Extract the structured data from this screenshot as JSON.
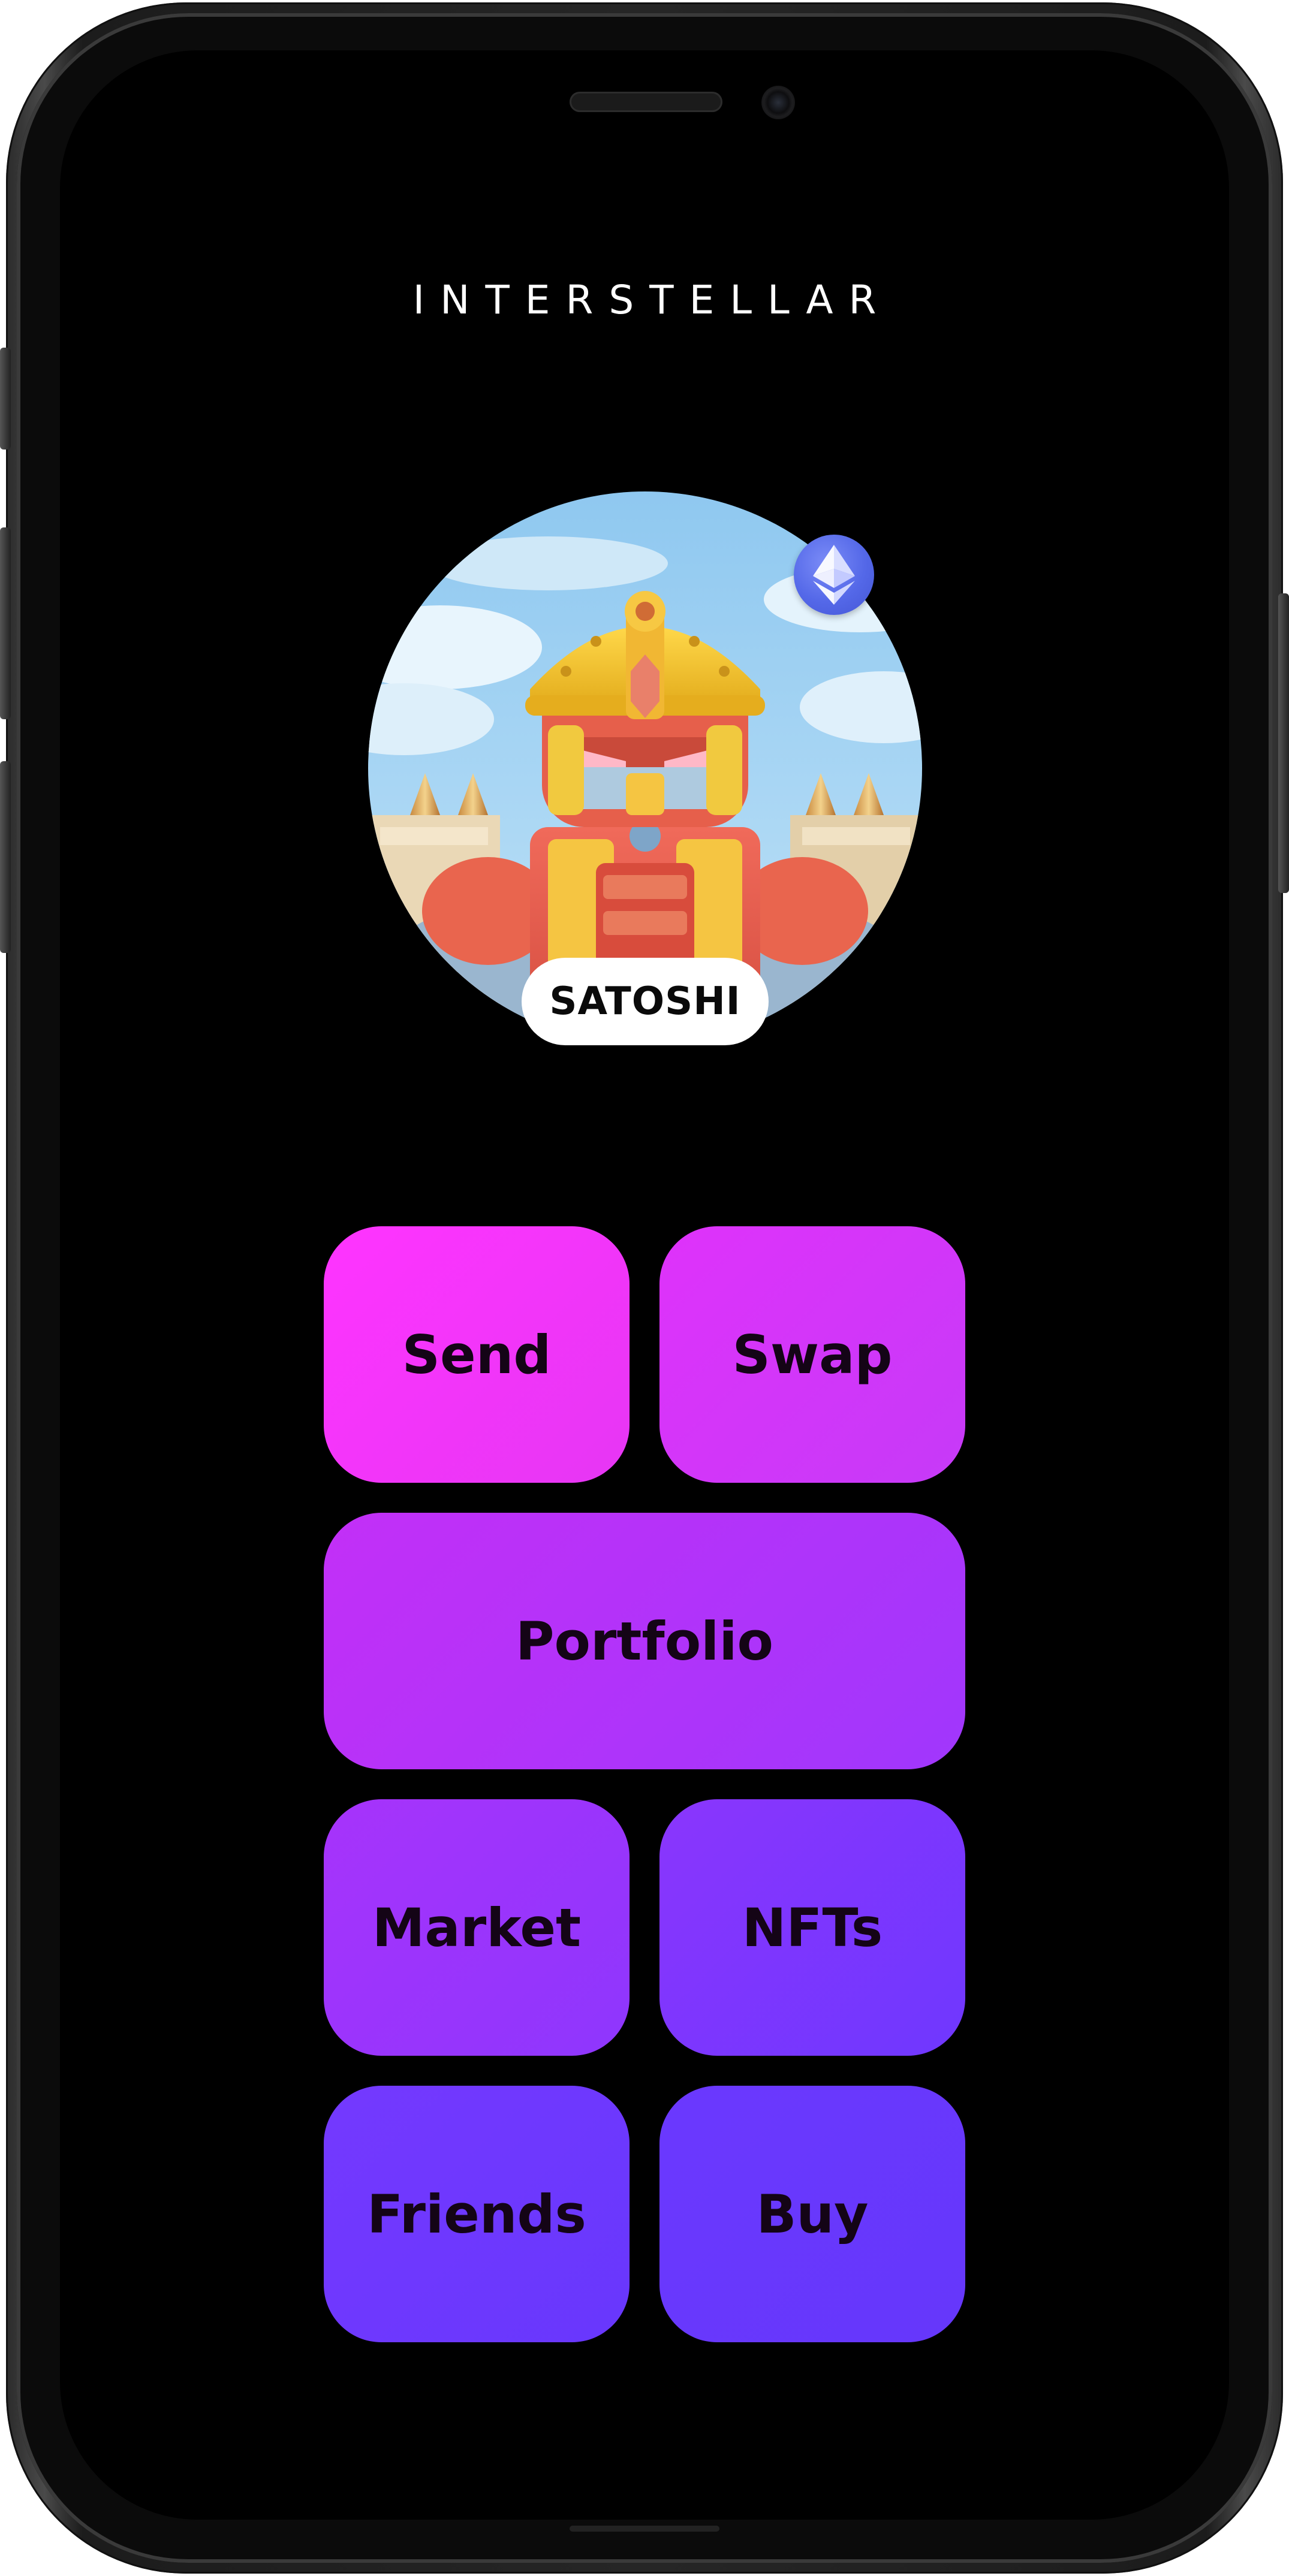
{
  "app": {
    "brand": "INTERSTELLAR"
  },
  "profile": {
    "username": "SATOSHI",
    "avatar_icon": "robot-avatar-icon",
    "network_badge_icon": "ethereum-icon"
  },
  "actions": {
    "send": "Send",
    "swap": "Swap",
    "portfolio": "Portfolio",
    "market": "Market",
    "nfts": "NFTs",
    "friends": "Friends",
    "buy": "Buy"
  },
  "colors": {
    "background": "#000000",
    "tile_gradient_start": "#ff34ff",
    "tile_gradient_end": "#6537fb",
    "tile_text": "#140416",
    "brand_text": "#ffffff",
    "ethereum_badge": "#5468e8"
  }
}
